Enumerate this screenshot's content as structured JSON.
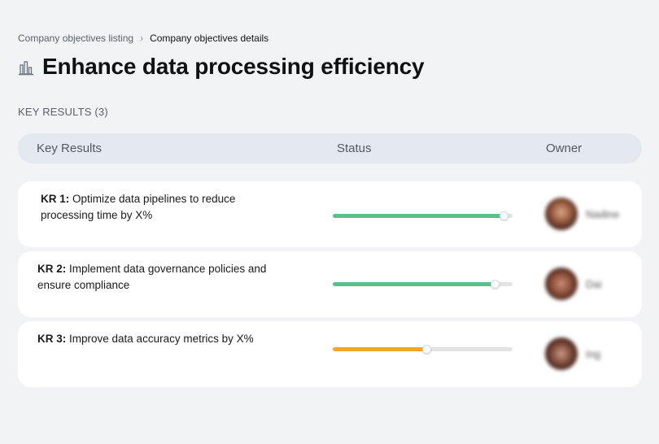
{
  "breadcrumb": {
    "parent": "Company objectives listing",
    "separator": "›",
    "current": "Company objectives details"
  },
  "objective": {
    "icon": "building-chart-icon",
    "title": "Enhance data processing efficiency"
  },
  "key_results_label": "KEY RESULTS (3)",
  "table": {
    "headers": {
      "key_results": "Key Results",
      "status": "Status",
      "owner": "Owner"
    },
    "rows": [
      {
        "prefix": "KR 1:",
        "text": " Optimize data pipelines to reduce processing time by X%",
        "progress": 0.95,
        "status_color": "#5cc08b",
        "owner_name": "Nadine"
      },
      {
        "prefix": "KR 2:",
        "text": " Implement data governance policies and ensure compliance",
        "progress": 0.9,
        "status_color": "#5cc08b",
        "owner_name": "Dai"
      },
      {
        "prefix": "KR 3:",
        "text": " Improve data accuracy metrics by X%",
        "progress": 0.52,
        "status_color": "#f5a62a",
        "owner_name": "Ing"
      }
    ]
  }
}
